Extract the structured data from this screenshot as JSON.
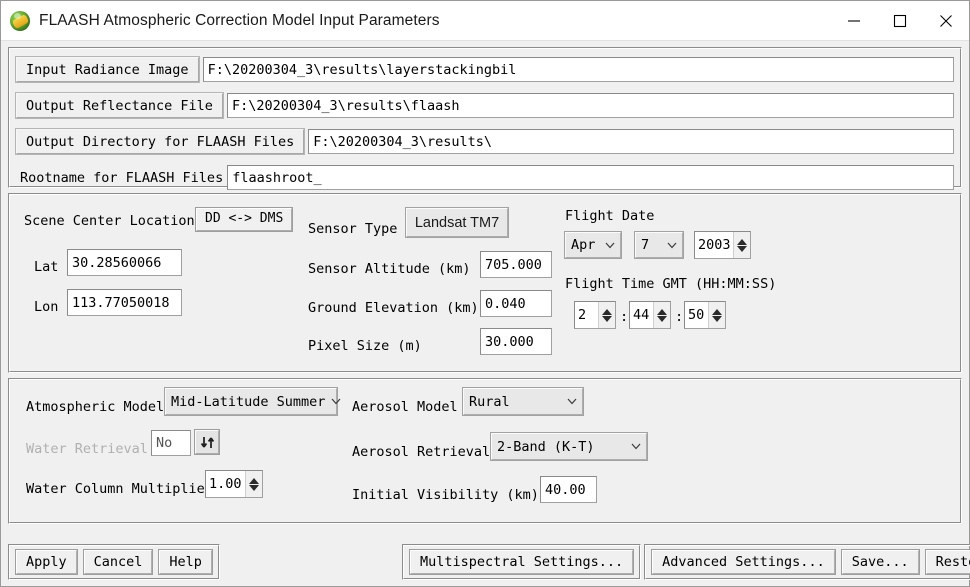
{
  "window": {
    "title": "FLAASH Atmospheric Correction Model Input Parameters",
    "icon": "envi-globe-icon",
    "controls": {
      "minimize": "minimize-icon",
      "maximize": "maximize-icon",
      "close": "close-icon"
    }
  },
  "files": {
    "rows": [
      {
        "label": "Input Radiance Image",
        "value": "F:\\20200304_3\\results\\layerstackingbil",
        "style": "button"
      },
      {
        "label": "Output Reflectance File",
        "value": "F:\\20200304_3\\results\\flaash",
        "style": "button"
      },
      {
        "label": "Output Directory for FLAASH Files",
        "value": "F:\\20200304_3\\results\\",
        "style": "button"
      },
      {
        "label": "Rootname for FLAASH Files",
        "value": "flaashroot_",
        "style": "plain"
      }
    ]
  },
  "scene": {
    "center_location_label": "Scene Center Location",
    "dd_dms_button": "DD <-> DMS",
    "lat_label": "Lat",
    "lat_value": "30.28560066",
    "lon_label": "Lon",
    "lon_value": "113.77050018",
    "sensor_type_label": "Sensor Type",
    "sensor_type_value": "Landsat TM7",
    "sensor_altitude_label": "Sensor Altitude (km)",
    "sensor_altitude_value": "705.000",
    "ground_elevation_label": "Ground Elevation (km)",
    "ground_elevation_value": "0.040",
    "pixel_size_label": "Pixel Size (m)",
    "pixel_size_value": "30.000",
    "flight_date_label": "Flight Date",
    "flight_month": "Apr",
    "flight_day": "7",
    "flight_year": "2003",
    "flight_time_label": "Flight Time GMT (HH:MM:SS)",
    "flight_hour": "2",
    "flight_minute": "44",
    "flight_second": "50",
    "time_sep": ":"
  },
  "model": {
    "atmospheric_model_label": "Atmospheric Model",
    "atmospheric_model_value": "Mid-Latitude Summer",
    "water_retrieval_label": "Water Retrieval",
    "water_retrieval_value": "No",
    "water_column_label": "Water Column Multiplier",
    "water_column_value": "1.00",
    "aerosol_model_label": "Aerosol Model",
    "aerosol_model_value": "Rural",
    "aerosol_retrieval_label": "Aerosol Retrieval",
    "aerosol_retrieval_value": "2-Band (K-T)",
    "initial_visibility_label": "Initial Visibility (km)",
    "initial_visibility_value": "40.00"
  },
  "footer": {
    "apply": "Apply",
    "cancel": "Cancel",
    "help": "Help",
    "multispectral": "Multispectral Settings...",
    "advanced": "Advanced Settings...",
    "save": "Save...",
    "restore": "Restore..."
  },
  "colors": {
    "window_bg": "#f0f0f0",
    "titlebar_bg": "#ffffff",
    "field_bg": "#ffffff",
    "border": "#a0a0a0",
    "disabled_text": "#b0b0b0"
  }
}
